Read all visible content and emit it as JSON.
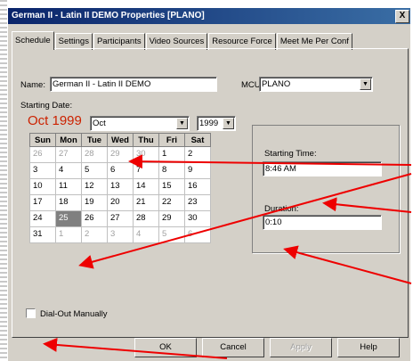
{
  "window": {
    "title": "German II - Latin II DEMO Properties  [PLANO]",
    "close_glyph": "X"
  },
  "tabs": [
    {
      "label": "Schedule"
    },
    {
      "label": "Settings"
    },
    {
      "label": "Participants"
    },
    {
      "label": "Video Sources"
    },
    {
      "label": "Resource Force"
    },
    {
      "label": "Meet Me Per Conf"
    }
  ],
  "form": {
    "name_label": "Name:",
    "name_value": "German II - Latin II DEMO",
    "mcu_label": "MCU:",
    "mcu_value": "PLANO",
    "starting_date_label": "Starting Date:"
  },
  "calendar": {
    "heading": "Oct 1999",
    "month_select": "Oct",
    "year_select": "1999",
    "weekdays": [
      "Sun",
      "Mon",
      "Tue",
      "Wed",
      "Thu",
      "Fri",
      "Sat"
    ],
    "weeks": [
      [
        "26",
        "27",
        "28",
        "29",
        "30",
        "1",
        "2"
      ],
      [
        "3",
        "4",
        "5",
        "6",
        "7",
        "8",
        "9"
      ],
      [
        "10",
        "11",
        "12",
        "13",
        "14",
        "15",
        "16"
      ],
      [
        "17",
        "18",
        "19",
        "20",
        "21",
        "22",
        "23"
      ],
      [
        "24",
        "25",
        "26",
        "27",
        "28",
        "29",
        "30"
      ],
      [
        "31",
        "1",
        "2",
        "3",
        "4",
        "5",
        "6"
      ]
    ],
    "selected_day": "25"
  },
  "time": {
    "starting_time_label": "Starting Time:",
    "starting_time_value": "8:46 AM",
    "duration_label": "Duration:",
    "duration_value": "0:10"
  },
  "dialout_label": "Dial-Out Manually",
  "buttons": {
    "ok": "OK",
    "cancel": "Cancel",
    "apply": "Apply",
    "help": "Help"
  },
  "colors": {
    "titlebar": "#0a246a",
    "month_heading": "#cc2200",
    "annotation_arrow": "#ee0000"
  }
}
